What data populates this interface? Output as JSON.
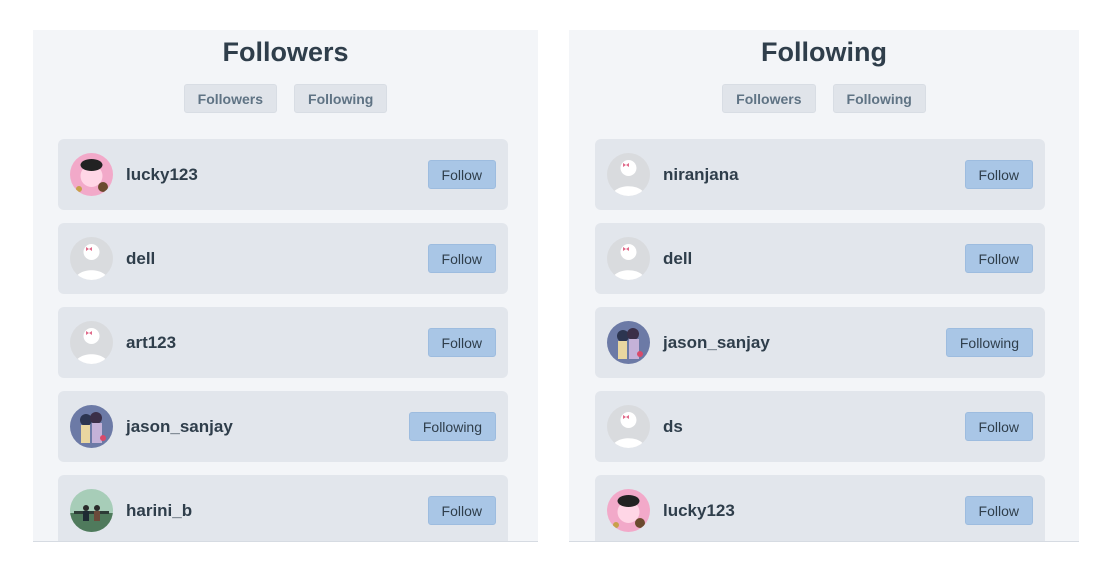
{
  "left": {
    "title": "Followers",
    "tabs": [
      "Followers",
      "Following"
    ],
    "users": [
      {
        "name": "lucky123",
        "button": "Follow",
        "avatar": "pink-character-avatar"
      },
      {
        "name": "dell",
        "button": "Follow",
        "avatar": "default-avatar"
      },
      {
        "name": "art123",
        "button": "Follow",
        "avatar": "default-avatar"
      },
      {
        "name": "jason_sanjay",
        "button": "Following",
        "avatar": "anime-couple-avatar"
      },
      {
        "name": "harini_b",
        "button": "Follow",
        "avatar": "green-scenery-avatar"
      }
    ]
  },
  "right": {
    "title": "Following",
    "tabs": [
      "Followers",
      "Following"
    ],
    "users": [
      {
        "name": "niranjana",
        "button": "Follow",
        "avatar": "default-avatar"
      },
      {
        "name": "dell",
        "button": "Follow",
        "avatar": "default-avatar"
      },
      {
        "name": "jason_sanjay",
        "button": "Following",
        "avatar": "anime-couple-avatar"
      },
      {
        "name": "ds",
        "button": "Follow",
        "avatar": "default-avatar"
      },
      {
        "name": "lucky123",
        "button": "Follow",
        "avatar": "pink-character-avatar"
      }
    ]
  },
  "colors": {
    "panel_bg": "#f3f5f8",
    "row_bg": "#e2e6ec",
    "button_bg": "#a9c6e6",
    "text_dark": "#2f3e4b"
  }
}
